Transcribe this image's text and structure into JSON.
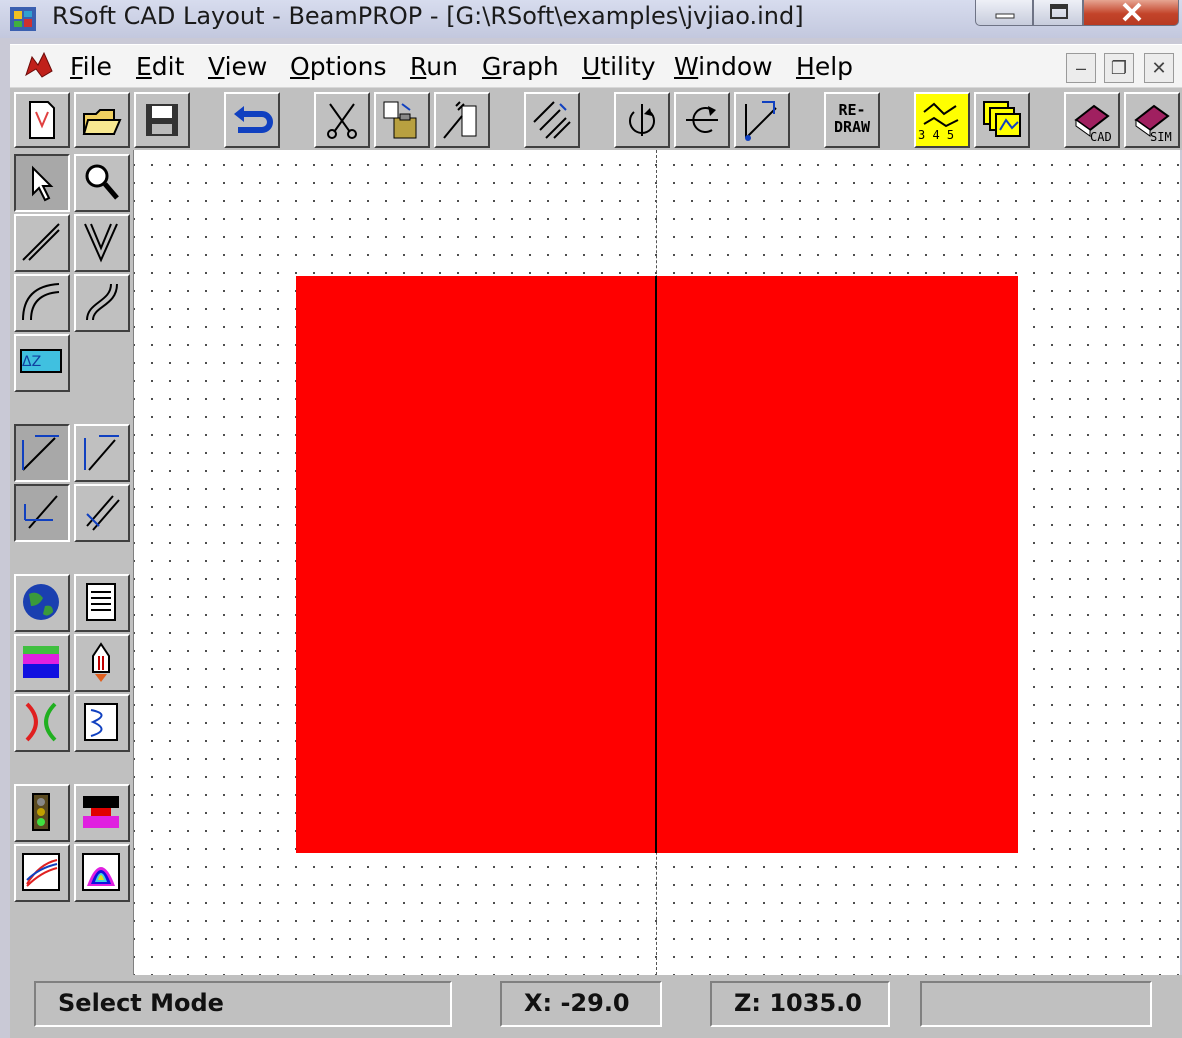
{
  "window": {
    "title": "RSoft CAD Layout - BeamPROP - [G:\\RSoft\\examples\\jvjiao.ind]"
  },
  "menu": {
    "items": [
      {
        "label": "File",
        "accel": "F",
        "rest": "ile"
      },
      {
        "label": "Edit",
        "accel": "E",
        "rest": "dit"
      },
      {
        "label": "View",
        "accel": "V",
        "rest": "iew"
      },
      {
        "label": "Options",
        "accel": "O",
        "rest": "ptions"
      },
      {
        "label": "Run",
        "accel": "R",
        "rest": "un"
      },
      {
        "label": "Graph",
        "accel": "G",
        "rest": "raph"
      },
      {
        "label": "Utility",
        "accel": "U",
        "rest": "tility"
      },
      {
        "label": "Window",
        "accel": "W",
        "rest": "indow"
      },
      {
        "label": "Help",
        "accel": "H",
        "rest": "elp"
      }
    ]
  },
  "toolbar": {
    "redraw_line1": "RE-",
    "redraw_line2": "DRAW",
    "cad_label": "CAD",
    "sim_label": "SIM",
    "runs_label": "3 4 5"
  },
  "palette": {
    "dz_label": "ΔZ"
  },
  "canvas": {
    "segment_color": "#ff0000"
  },
  "status": {
    "mode": "Select Mode",
    "x": "X: -29.0",
    "z": "Z: 1035.0",
    "extra": ""
  }
}
